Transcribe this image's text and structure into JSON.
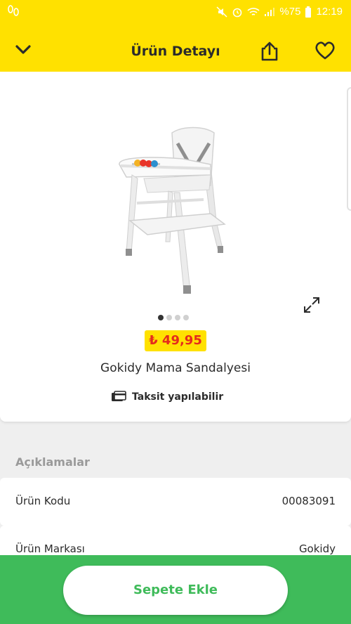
{
  "status_bar": {
    "battery_text": "%75",
    "time": "12:19"
  },
  "header": {
    "title": "Ürün Detayı"
  },
  "product": {
    "image_count": 4,
    "active_image_index": 0,
    "price": "₺ 49,95",
    "name": "Gokidy Mama Sandalyesi",
    "installment_text": "Taksit yapılabilir"
  },
  "details": {
    "section_title": "Açıklamalar",
    "rows": [
      {
        "label": "Ürün Kodu",
        "value": "00083091"
      },
      {
        "label": "Ürün Markası",
        "value": "Gokidy"
      }
    ]
  },
  "bottom": {
    "add_to_cart_label": "Sepete Ekle"
  },
  "icons": {
    "back": "chevron-down-icon",
    "share": "share-icon",
    "favorite": "heart-icon",
    "expand": "expand-icon",
    "installment": "credit-card-icon"
  },
  "colors": {
    "header_yellow": "#ffe100",
    "price_red": "#e52b1c",
    "cart_green": "#3fbb5a"
  }
}
